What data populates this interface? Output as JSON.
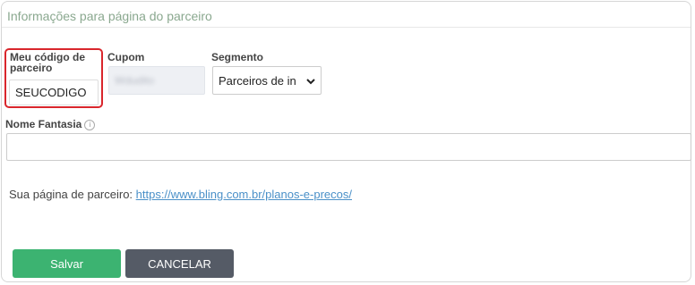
{
  "card": {
    "title": "Informações para página do parceiro"
  },
  "fields": {
    "code": {
      "label": "Meu código de parceiro",
      "value": "SEUCODIGO"
    },
    "cupom": {
      "label": "Cupom",
      "value": "Wdudito"
    },
    "segmento": {
      "label": "Segmento",
      "selected": "Parceiros de in"
    },
    "nome_fantasia": {
      "label": "Nome Fantasia",
      "value": ""
    }
  },
  "partner_page": {
    "label": "Sua página de parceiro:",
    "url": "https://www.bling.com.br/planos-e-precos/"
  },
  "actions": {
    "save_label": "Salvar",
    "cancel_label": "CANCELAR"
  },
  "colors": {
    "highlight": "#d9262c",
    "save": "#3cb371",
    "cancel": "#555b66",
    "link": "#4a90c8",
    "title": "#8aa88f"
  },
  "icons": {
    "info": "info-icon",
    "select_chevron": "chevron-down-icon"
  }
}
